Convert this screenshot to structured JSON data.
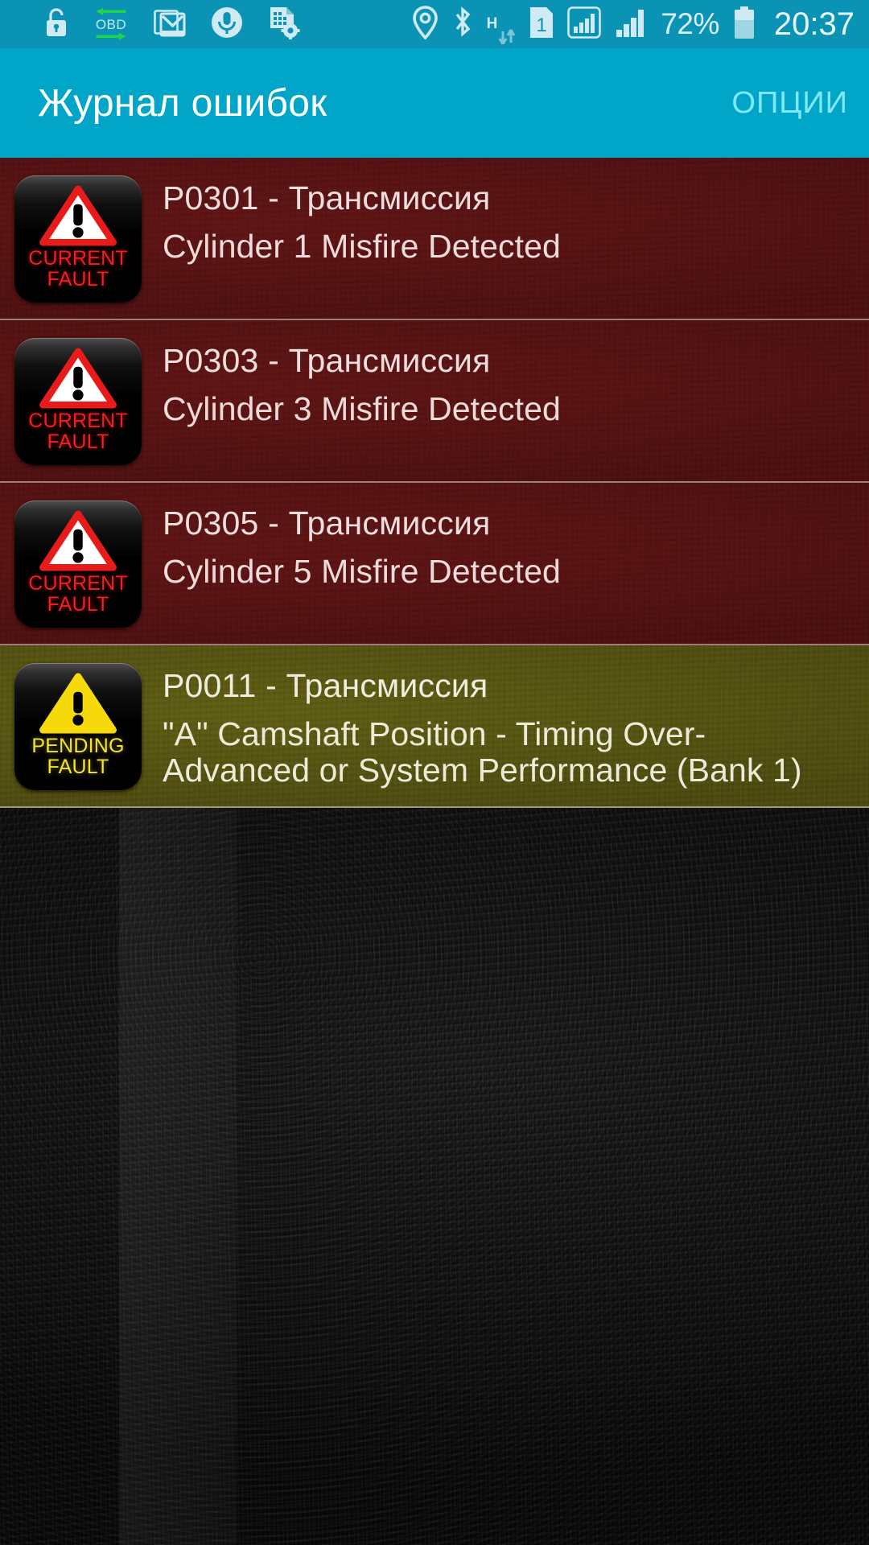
{
  "status_bar": {
    "background_color": "#0b93b5",
    "left_icons": [
      {
        "name": "lock-icon",
        "label": "lock"
      },
      {
        "name": "obd-sync-icon",
        "label": "OBD"
      },
      {
        "name": "gmail-icon",
        "label": "gmail"
      },
      {
        "name": "microphone-icon",
        "label": "mic"
      },
      {
        "name": "document-settings-icon",
        "label": "doc-settings"
      }
    ],
    "right_icons": [
      {
        "name": "location-icon",
        "label": "location"
      },
      {
        "name": "bluetooth-icon",
        "label": "bluetooth"
      },
      {
        "name": "hspa-data-icon",
        "label": "H"
      },
      {
        "name": "sim-slot-icon",
        "label": "1"
      },
      {
        "name": "signal-sim1-icon",
        "label": "signal"
      },
      {
        "name": "signal-sim2-icon",
        "label": "signal"
      }
    ],
    "battery_percent": "72%",
    "battery_icon": "battery-icon",
    "clock": "20:37"
  },
  "app_bar": {
    "background_color": "#00a5c8",
    "title": "Журнал ошибок",
    "options_label": "ОПЦИИ",
    "options_color": "#7fe9f7"
  },
  "fault_list": {
    "items": [
      {
        "badge_line1": "CURRENT",
        "badge_line2": "FAULT",
        "badge_type": "current",
        "badge_color": "#f02020",
        "row_color": "#5c1414",
        "code": "P0301 - Трансмиссия",
        "description": "Cylinder 1 Misfire Detected"
      },
      {
        "badge_line1": "CURRENT",
        "badge_line2": "FAULT",
        "badge_type": "current",
        "badge_color": "#f02020",
        "row_color": "#5c1414",
        "code": "P0303 - Трансмиссия",
        "description": "Cylinder 3 Misfire Detected"
      },
      {
        "badge_line1": "CURRENT",
        "badge_line2": "FAULT",
        "badge_type": "current",
        "badge_color": "#f02020",
        "row_color": "#5c1414",
        "code": "P0305 - Трансмиссия",
        "description": "Cylinder 5 Misfire Detected"
      },
      {
        "badge_line1": "PENDING",
        "badge_line2": "FAULT",
        "badge_type": "pending",
        "badge_color": "#f5e327",
        "row_color": "#5c5a14",
        "code": "P0011 - Трансмиссия",
        "description": "\"A\" Camshaft Position - Timing Over-Advanced or System Performance (Bank 1)"
      }
    ]
  },
  "empty_area": {
    "background_color": "#161616"
  }
}
